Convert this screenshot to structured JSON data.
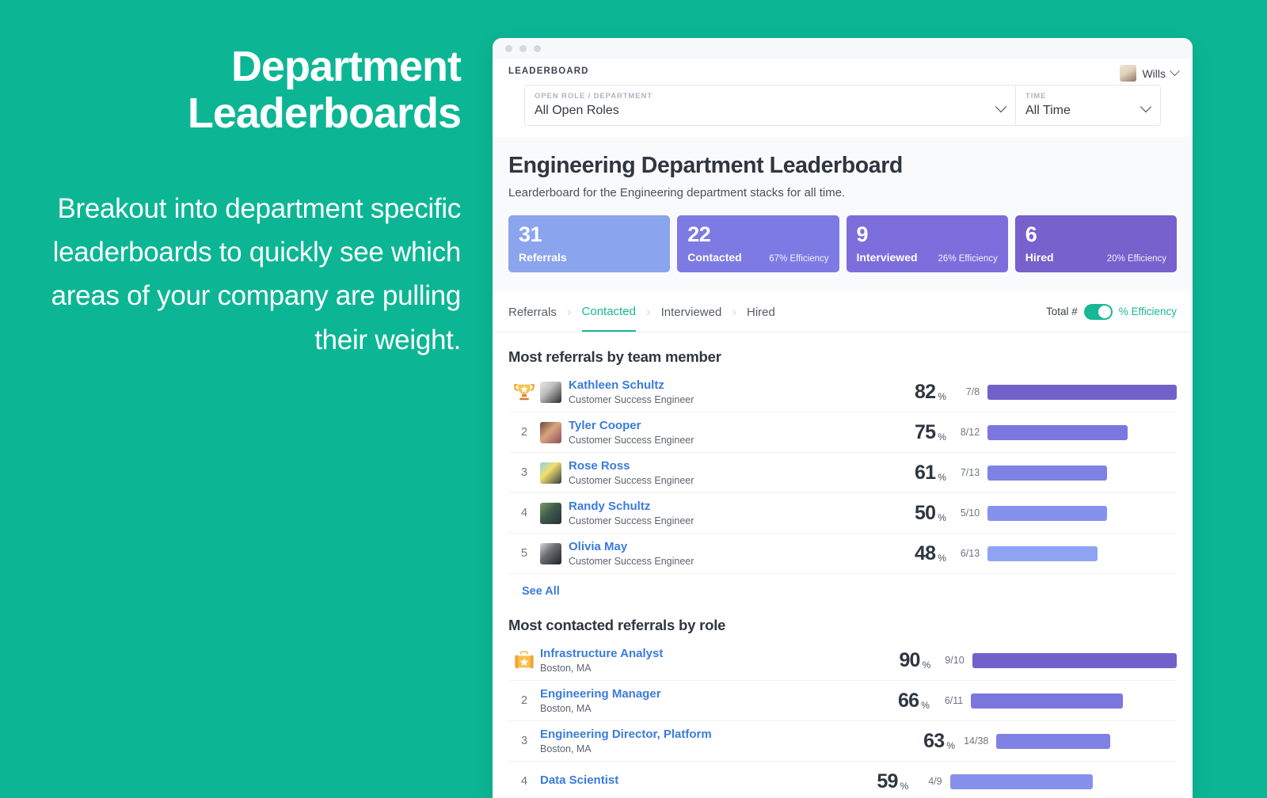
{
  "theme": {
    "background": "#0cb694",
    "accent_teal": "#17b894",
    "link_blue": "#3b7bdb"
  },
  "promo": {
    "title": "Department Leaderboards",
    "body": "Breakout into department specific leaderboards to quickly see which areas of your company are pulling their weight."
  },
  "window": {
    "app_label": "LEADERBOARD",
    "user": {
      "name": "Wills",
      "avatar_icon": "user-avatar",
      "chevron_icon": "chevron-down-icon"
    },
    "filters": [
      {
        "label": "OPEN ROLE / DEPARTMENT",
        "value": "All Open Roles"
      },
      {
        "label": "TIME",
        "value": "All Time"
      }
    ]
  },
  "board": {
    "title": "Engineering Department Leaderboard",
    "subtitle": "Learderboard for the Engineering department stacks for all time.",
    "stats": [
      {
        "value": "31",
        "label": "Referrals",
        "efficiency": "",
        "color": "#8ba4ee"
      },
      {
        "value": "22",
        "label": "Contacted",
        "efficiency": "67% Efficiency",
        "color": "#7d7ae4"
      },
      {
        "value": "9",
        "label": "Interviewed",
        "efficiency": "26% Efficiency",
        "color": "#7b6edc"
      },
      {
        "value": "6",
        "label": "Hired",
        "efficiency": "20% Efficiency",
        "color": "#7661cd"
      }
    ],
    "tabs": [
      {
        "label": "Referrals",
        "active": false
      },
      {
        "label": "Contacted",
        "active": true
      },
      {
        "label": "Interviewed",
        "active": false
      },
      {
        "label": "Hired",
        "active": false
      }
    ],
    "tab_separator": "›",
    "toggle": {
      "left_label": "Total #",
      "right_label": "% Efficiency",
      "on": true
    }
  },
  "chart_data": {
    "type": "bar",
    "title": "Most referrals by team member",
    "xlabel": "",
    "ylabel": "",
    "xlim": [
      0,
      100
    ],
    "grid": false,
    "legend": "none",
    "categories": [
      "Kathleen Schultz",
      "Tyler Cooper",
      "Rose Ross",
      "Randy Schultz",
      "Olivia May"
    ],
    "values": [
      82,
      75,
      61,
      50,
      48
    ],
    "fractions": [
      "7/8",
      "8/12",
      "7/13",
      "5/10",
      "6/13"
    ]
  },
  "sections": [
    {
      "title": "Most referrals by team member",
      "see_all": "See All",
      "rows": [
        {
          "rank": "1",
          "badge": "trophy-icon",
          "avatar": "av1",
          "name": "Kathleen Schultz",
          "sub": "Customer Success Engineer",
          "pct": "82",
          "pct_sign": "%",
          "frac": "7/8",
          "bar_pct": 100,
          "bar_color": "#7161c9"
        },
        {
          "rank": "2",
          "badge": "",
          "avatar": "av2",
          "name": "Tyler Cooper",
          "sub": "Customer Success Engineer",
          "pct": "75",
          "pct_sign": "%",
          "frac": "8/12",
          "bar_pct": 74,
          "bar_color": "#7c76df"
        },
        {
          "rank": "3",
          "badge": "",
          "avatar": "av3",
          "name": "Rose Ross",
          "sub": "Customer Success Engineer",
          "pct": "61",
          "pct_sign": "%",
          "frac": "7/13",
          "bar_pct": 63,
          "bar_color": "#7f82e4"
        },
        {
          "rank": "4",
          "badge": "",
          "avatar": "av4",
          "name": "Randy Schultz",
          "sub": "Customer Success Engineer",
          "pct": "50",
          "pct_sign": "%",
          "frac": "5/10",
          "bar_pct": 63,
          "bar_color": "#8691ed"
        },
        {
          "rank": "5",
          "badge": "",
          "avatar": "av5",
          "name": "Olivia May",
          "sub": "Customer Success Engineer",
          "pct": "48",
          "pct_sign": "%",
          "frac": "6/13",
          "bar_pct": 58,
          "bar_color": "#8fa3f3"
        }
      ]
    },
    {
      "title": "Most contacted referrals by role",
      "see_all": "",
      "rows": [
        {
          "rank": "1",
          "badge": "briefcase-icon",
          "avatar": "",
          "name": "Infrastructure Analyst",
          "sub": "Boston, MA",
          "pct": "90",
          "pct_sign": "%",
          "frac": "9/10",
          "bar_pct": 100,
          "bar_color": "#7161c9"
        },
        {
          "rank": "2",
          "badge": "",
          "avatar": "",
          "name": "Engineering Manager",
          "sub": "Boston, MA",
          "pct": "66",
          "pct_sign": "%",
          "frac": "6/11",
          "bar_pct": 74,
          "bar_color": "#7c76df"
        },
        {
          "rank": "3",
          "badge": "",
          "avatar": "",
          "name": "Engineering Director, Platform",
          "sub": "Boston, MA",
          "pct": "63",
          "pct_sign": "%",
          "frac": "14/38",
          "bar_pct": 63,
          "bar_color": "#7f82e4"
        },
        {
          "rank": "4",
          "badge": "",
          "avatar": "",
          "name": "Data Scientist",
          "sub": "",
          "pct": "59",
          "pct_sign": "%",
          "frac": "4/9",
          "bar_pct": 63,
          "bar_color": "#8691ed"
        }
      ]
    }
  ]
}
